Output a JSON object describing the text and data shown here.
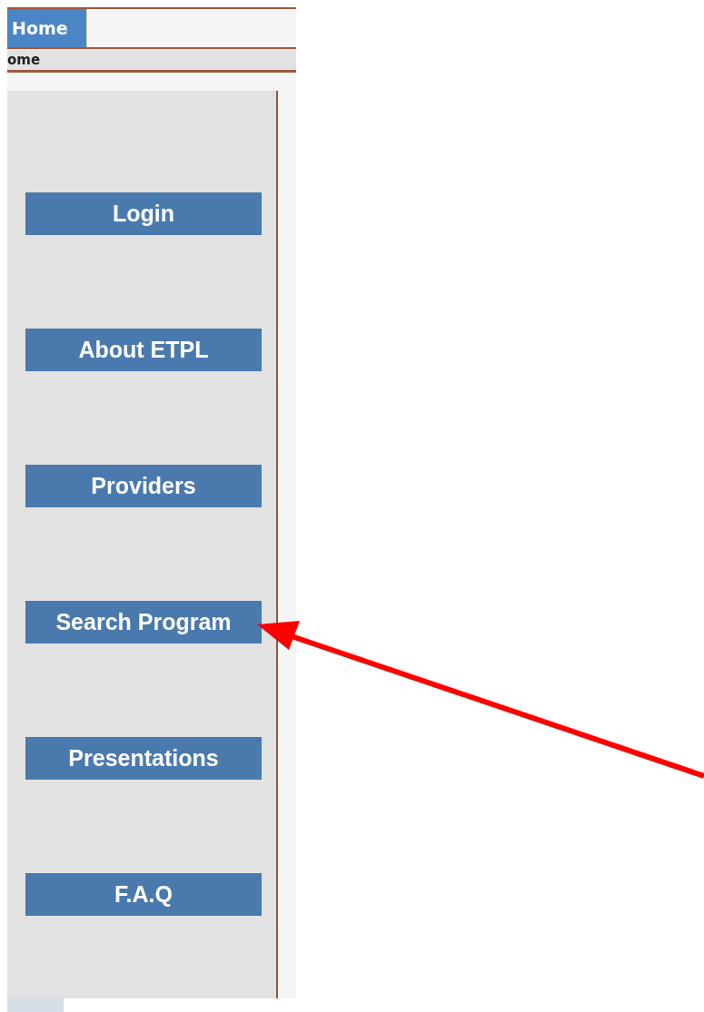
{
  "tabs": [
    {
      "label": "Home",
      "selected": true
    }
  ],
  "breadcrumb": "ome",
  "sidebar": {
    "buttons": [
      {
        "label": "Login"
      },
      {
        "label": "About ETPL"
      },
      {
        "label": "Providers"
      },
      {
        "label": "Search Program"
      },
      {
        "label": "Presentations"
      },
      {
        "label": "F.A.Q"
      }
    ]
  },
  "annotation": {
    "kind": "arrow"
  }
}
